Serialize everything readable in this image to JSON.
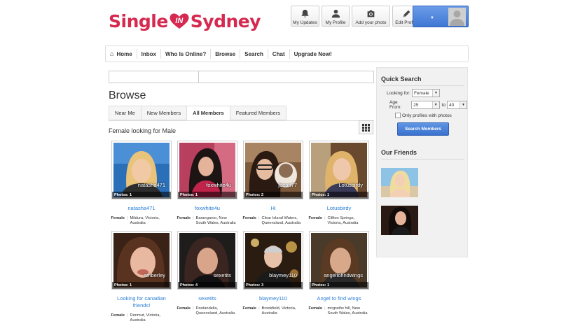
{
  "logo": {
    "part1": "Single",
    "part2": "IN",
    "part3": "Sydney"
  },
  "header_buttons": [
    {
      "label": "My Updates",
      "icon": "bell-icon"
    },
    {
      "label": "My Profile",
      "icon": "user-icon"
    },
    {
      "label": "Add your photo",
      "icon": "camera-icon"
    },
    {
      "label": "Edit Profile",
      "icon": "pencil-icon"
    }
  ],
  "nav": {
    "items": [
      "Home",
      "Inbox",
      "Who Is Online?",
      "Browse",
      "Search",
      "Chat",
      "Upgrade Now!"
    ]
  },
  "page_title": "Browse",
  "tabs": [
    "Near Me",
    "New Members",
    "All Members",
    "Featured Members"
  ],
  "active_tab": "All Members",
  "section_title": "Female looking for Male",
  "members": [
    {
      "username": "natasha471",
      "title": "natasha471",
      "photos": "Photos: 1",
      "gender": "Female",
      "location": "Mildura, Victoria, Australia"
    },
    {
      "username": "foxwhite4u",
      "title": "foxwhite4u",
      "photos": "Photos: 1",
      "gender": "Female",
      "location": "Barangaroo, New South Wales, Australia"
    },
    {
      "username": "jbean77",
      "title": "Hi",
      "photos": "Photos: 2",
      "gender": "Female",
      "location": "Clear Island Waters, Queensland, Australia"
    },
    {
      "username": "Lotusbirdy",
      "title": "Lotusbirdy",
      "photos": "Photos: 1",
      "gender": "Female",
      "location": "Clifton Springs, Victoria, Australia"
    },
    {
      "username": "amberley",
      "title": "Looking for canadian friends!",
      "photos": "Photos: 1",
      "gender": "Female",
      "location": "Denmut, Victoria, Australia"
    },
    {
      "username": "sexetits",
      "title": "sexetits",
      "photos": "Photos: 4",
      "gender": "Female",
      "location": "Doolandella, Queensland, Australia"
    },
    {
      "username": "blaymey110",
      "title": "blaymey110",
      "photos": "Photos: 3",
      "gender": "Female",
      "location": "Brookfield, Victoria, Australia"
    },
    {
      "username": "angeltofindwings",
      "title": "Angel to find wings",
      "photos": "Photos: 1",
      "gender": "Female",
      "location": "mcgraths hill, New South Wales, Australia"
    }
  ],
  "quick_search": {
    "title": "Quick Search",
    "looking_for_label": "Looking for:",
    "looking_for_value": "Female",
    "age_from_label": "Age From:",
    "age_from_value": "25",
    "age_to_label": "to",
    "age_to_value": "40",
    "photos_only_label": "Only profiles with photos",
    "button_label": "Search Members"
  },
  "friends": {
    "title": "Our Friends"
  },
  "colors": {
    "brand": "#d6294f",
    "link": "#2a7fd4",
    "button": "#3b72cf"
  }
}
